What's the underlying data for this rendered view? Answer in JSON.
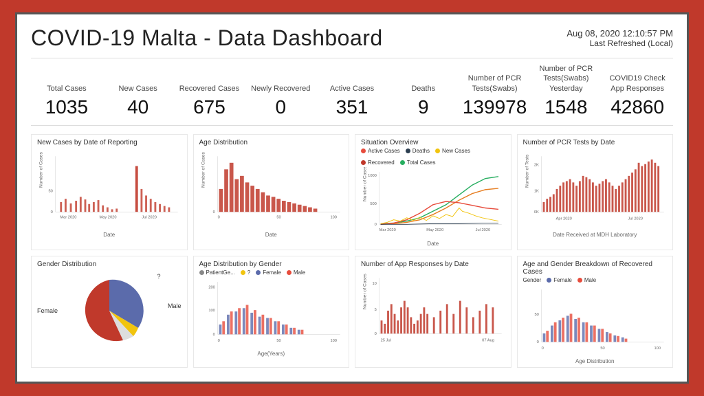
{
  "header": {
    "title": "COVID-19 Malta - Data Dashboard",
    "datetime": "Aug 08, 2020 12:10:57 PM",
    "last_refreshed": "Last Refreshed (Local)"
  },
  "kpis": [
    {
      "label": "Total Cases",
      "value": "1035"
    },
    {
      "label": "New Cases",
      "value": "40"
    },
    {
      "label": "Recovered Cases",
      "value": "675"
    },
    {
      "label": "Newly Recovered",
      "value": "0"
    },
    {
      "label": "Active Cases",
      "value": "351"
    },
    {
      "label": "Deaths",
      "value": "9"
    },
    {
      "label": "Number of PCR Tests(Swabs)",
      "value": "139978"
    },
    {
      "label": "Number of PCR Tests(Swabs) Yesterday",
      "value": "1548"
    },
    {
      "label": "COVID19 Check App Responses",
      "value": "42860"
    }
  ],
  "charts": {
    "new_cases": {
      "title": "New Cases by Date of Reporting",
      "y_label": "Number of Cases",
      "x_label": "Date",
      "x_ticks": [
        "Mar 2020",
        "May 2020",
        "Jul 2020"
      ]
    },
    "age_dist": {
      "title": "Age Distribution",
      "y_label": "Number of Cases",
      "x_label": "Date",
      "x_ticks": [
        "0",
        "50",
        "100"
      ]
    },
    "situation": {
      "title": "Situation Overview",
      "y_label": "Number of Cases",
      "x_label": "Date",
      "y_ticks": [
        "0",
        "500",
        "1000"
      ],
      "x_ticks": [
        "Mar 2020",
        "May 2020",
        "Jul 2020"
      ],
      "legend": [
        {
          "label": "Active Cases",
          "color": "#e74c3c"
        },
        {
          "label": "Deaths",
          "color": "#2c3e50"
        },
        {
          "label": "New Cases",
          "color": "#f1c40f"
        },
        {
          "label": "Recovered",
          "color": "#c0392b"
        },
        {
          "label": "Total Cases",
          "color": "#27ae60"
        }
      ]
    },
    "pcr_tests": {
      "title": "Number of PCR Tests by Date",
      "y_label": "Number of Tests",
      "x_label": "Date Received at MDH Laboratory",
      "y_ticks": [
        "0K",
        "1K",
        "2K"
      ],
      "x_ticks": [
        "Apr 2020",
        "Jul 2020"
      ]
    },
    "gender_dist": {
      "title": "Gender Distribution",
      "segments": [
        {
          "label": "Female",
          "color": "#5b6bab",
          "pct": 45
        },
        {
          "label": "Male",
          "color": "#e8e8e8",
          "pct": 10
        },
        {
          "label": "?",
          "color": "#f1c40f",
          "pct": 5
        },
        {
          "label": "Male (main)",
          "color": "#c0392b",
          "pct": 40
        }
      ]
    },
    "age_gender": {
      "title": "Age Distribution by Gender",
      "y_label": "Number of Cases",
      "x_label": "Age(Years)",
      "legend": [
        {
          "label": "PatientGe...",
          "color": "#888"
        },
        {
          "label": "?",
          "color": "#f1c40f"
        },
        {
          "label": "Female",
          "color": "#5b6bab"
        },
        {
          "label": "Male",
          "color": "#e74c3c"
        }
      ],
      "y_ticks": [
        "0",
        "100",
        "200"
      ],
      "x_ticks": [
        "0",
        "50",
        "100"
      ]
    },
    "app_responses": {
      "title": "Number of App Responses by Date",
      "y_label": "Number of Cases",
      "y_ticks": [
        "0",
        "5",
        "10"
      ],
      "x_ticks": [
        "25 Jul",
        "07 Aug"
      ]
    },
    "age_gender_recovered": {
      "title": "Age and Gender Breakdown of Recovered Cases",
      "y_label": "Number of Cases",
      "x_label": "Age Distribution",
      "legend": [
        {
          "label": "Female",
          "color": "#5b6bab"
        },
        {
          "label": "Male",
          "color": "#e74c3c"
        }
      ],
      "y_ticks": [
        "0",
        "50"
      ],
      "x_ticks": [
        "0",
        "50",
        "100"
      ]
    }
  }
}
